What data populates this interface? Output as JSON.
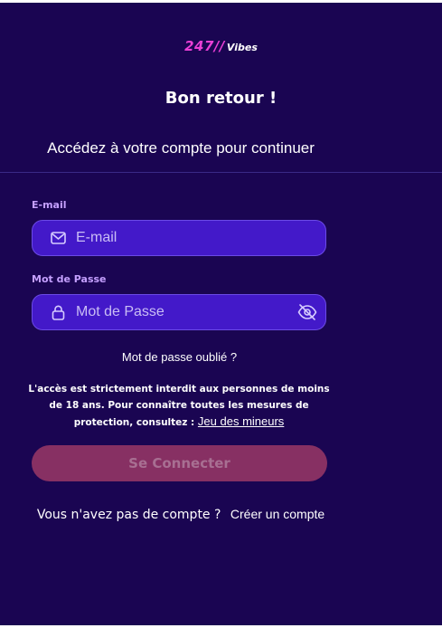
{
  "logo": {
    "mark": "247//",
    "text": "Vibes"
  },
  "title": "Bon retour !",
  "subtitle": "Accédez à votre compte pour continuer",
  "email": {
    "label": "E-mail",
    "placeholder": "E-mail",
    "value": "",
    "icon": "mail-icon"
  },
  "password": {
    "label": "Mot de Passe",
    "placeholder": "Mot de Passe",
    "value": "",
    "icon": "lock-icon",
    "toggle_icon": "eye-off-icon"
  },
  "forgot": "Mot de passe oublié ?",
  "notice": {
    "text": "L'accès est strictement interdit aux personnes de moins de 18 ans. Pour connaître toutes les mesures de protection, consultez :",
    "link": "Jeu des mineurs"
  },
  "submit_label": "Se Connecter",
  "signup": {
    "question": "Vous n'avez pas de compte ?",
    "link": "Créer un compte"
  },
  "colors": {
    "background": "#1a0552",
    "input_background": "#4319c9",
    "label": "#c5a0ff",
    "logo_accent": "#ea3fd6",
    "button_disabled": "#873063"
  }
}
